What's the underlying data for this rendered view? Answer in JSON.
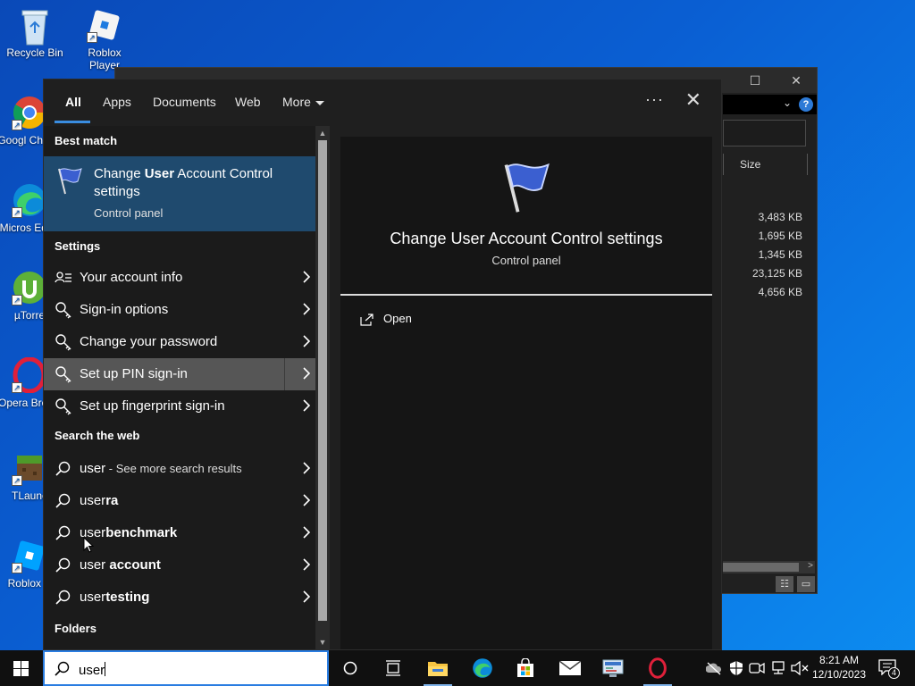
{
  "desktop": {
    "icons": [
      {
        "label": "Recycle Bin"
      },
      {
        "label": "Roblox Player"
      },
      {
        "label": "Googl Chrom"
      },
      {
        "label": "Micros Edge"
      },
      {
        "label": "µTorre"
      },
      {
        "label": "Opera Brows"
      },
      {
        "label": "TLaunc"
      },
      {
        "label": "Roblox S"
      }
    ]
  },
  "explorer": {
    "column_size": "Size",
    "sizes": [
      "3,483 KB",
      "1,695 KB",
      "1,345 KB",
      "23,125 KB",
      "4,656 KB"
    ]
  },
  "search": {
    "tabs": [
      {
        "label": "All"
      },
      {
        "label": "Apps"
      },
      {
        "label": "Documents"
      },
      {
        "label": "Web"
      },
      {
        "label": "More"
      }
    ],
    "best_match_header": "Best match",
    "best_match": {
      "title_pre": "Change ",
      "title_bold": "User",
      "title_post": " Account Control settings",
      "sub": "Control panel"
    },
    "settings_header": "Settings",
    "settings": [
      {
        "label": "Your account info"
      },
      {
        "label": "Sign-in options"
      },
      {
        "label": "Change your password"
      },
      {
        "label": "Set up PIN sign-in"
      },
      {
        "label": "Set up fingerprint sign-in"
      }
    ],
    "web_header": "Search the web",
    "web": [
      {
        "pre": "user",
        "bold": "",
        "extra": " - See more search results"
      },
      {
        "pre": "user",
        "bold": "ra",
        "extra": ""
      },
      {
        "pre": "user",
        "bold": "benchmark",
        "extra": ""
      },
      {
        "pre": "user",
        "bold": " account",
        "extra": ""
      },
      {
        "pre": "user",
        "bold": "testing",
        "extra": ""
      }
    ],
    "folders_header": "Folders",
    "preview": {
      "title": "Change User Account Control settings",
      "sub": "Control panel",
      "open": "Open"
    },
    "query": "user"
  },
  "taskbar": {
    "time": "8:21 AM",
    "date": "12/10/2023",
    "notifications": "4"
  },
  "colors": {
    "accent": "#3a8de0",
    "best_match_bg": "#1f4a6e",
    "hover_bg": "#565656"
  }
}
